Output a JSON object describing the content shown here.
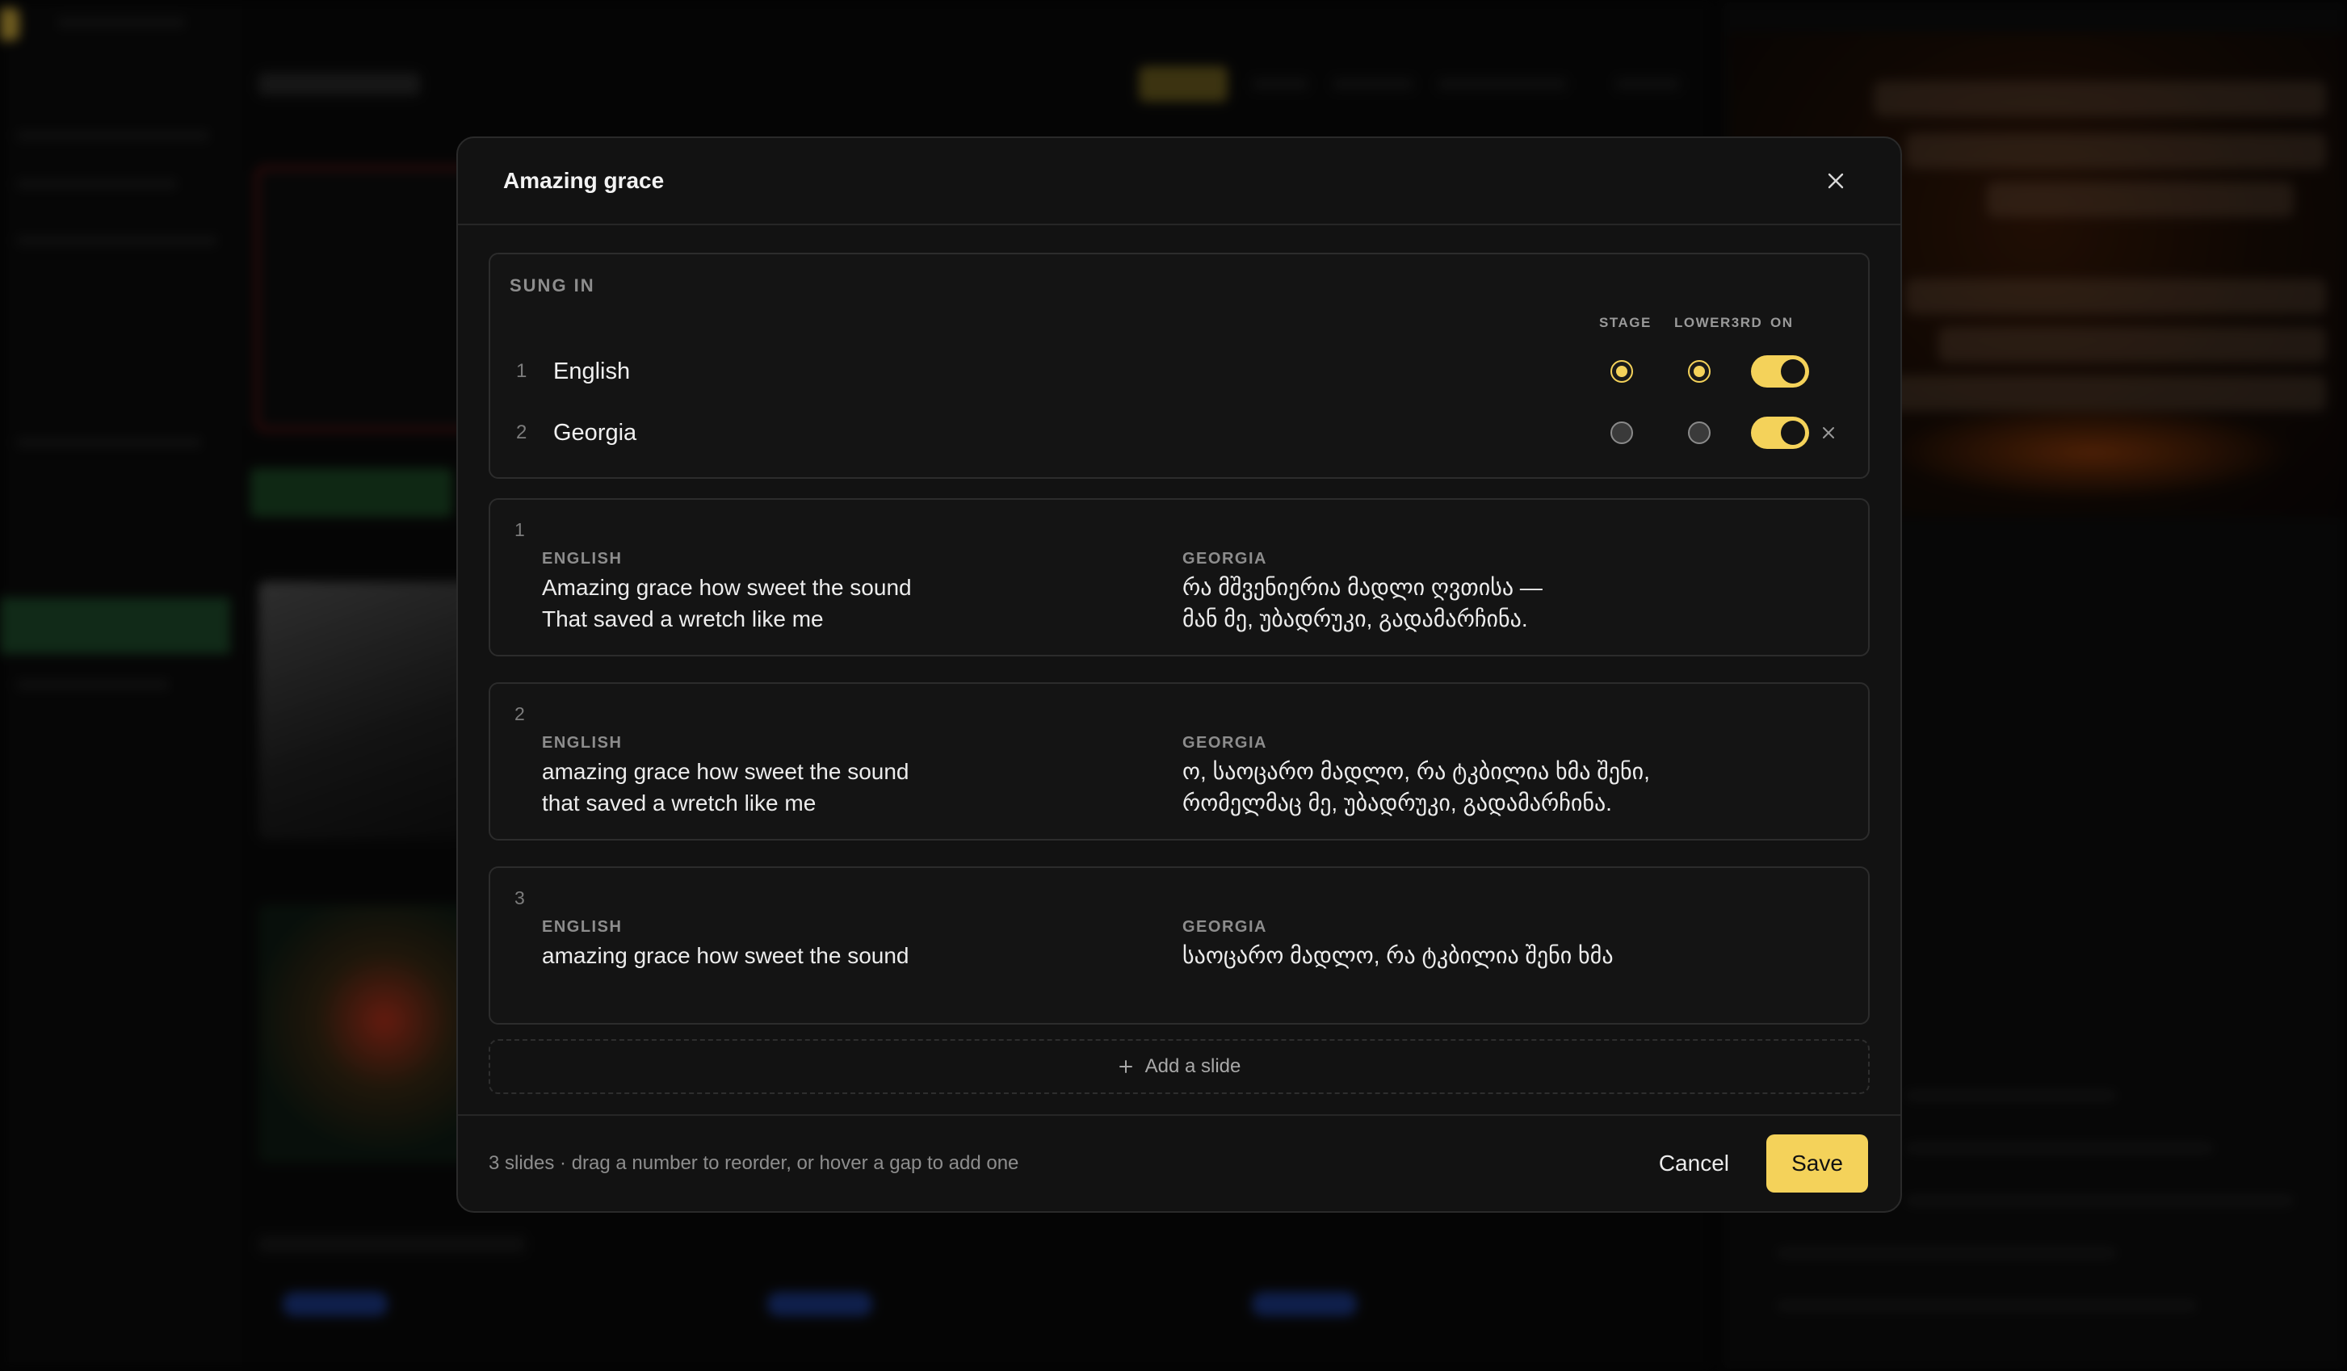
{
  "modal": {
    "title": "Amazing grace",
    "close_icon": "close-icon"
  },
  "languages": {
    "section_label": "SUNG IN",
    "columns": {
      "stage": "STAGE",
      "lower3rd": "LOWER3RD",
      "on": "ON"
    },
    "items": [
      {
        "num": "1",
        "name": "English",
        "stage": true,
        "lower3rd": true,
        "on": true,
        "removable": false
      },
      {
        "num": "2",
        "name": "Georgia",
        "stage": false,
        "lower3rd": false,
        "on": true,
        "removable": true
      }
    ]
  },
  "slides": [
    {
      "num": "1",
      "left_label": "ENGLISH",
      "left_lines": [
        "Amazing grace how sweet the sound",
        "That saved a wretch like me"
      ],
      "right_label": "GEORGIA",
      "right_lines": [
        "რა მშვენიერია მადლი ღვთისა —",
        "მან მე, უბადრუკი, გადამარჩინა."
      ]
    },
    {
      "num": "2",
      "left_label": "ENGLISH",
      "left_lines": [
        "amazing grace how sweet the sound",
        "that saved a wretch like me"
      ],
      "right_label": "GEORGIA",
      "right_lines": [
        "ო, საოცარო მადლო, რა ტკბილია ხმა შენი,",
        "რომელმაც მე, უბადრუკი, გადამარჩინა."
      ]
    },
    {
      "num": "3",
      "left_label": "ENGLISH",
      "left_lines": [
        "amazing grace how sweet the sound"
      ],
      "right_label": "GEORGIA",
      "right_lines": [
        "საოცარო მადლო, რა ტკბილია შენი ხმა"
      ]
    }
  ],
  "add_slide": {
    "label": "Add a slide",
    "icon": "plus-icon"
  },
  "footer": {
    "hint": "3 slides · drag a number to reorder, or hover a gap to add one",
    "cancel_label": "Cancel",
    "save_label": "Save"
  },
  "colors": {
    "accent": "#f4d25a",
    "modal_bg": "#121212",
    "panel_border": "#2c2c2c"
  }
}
